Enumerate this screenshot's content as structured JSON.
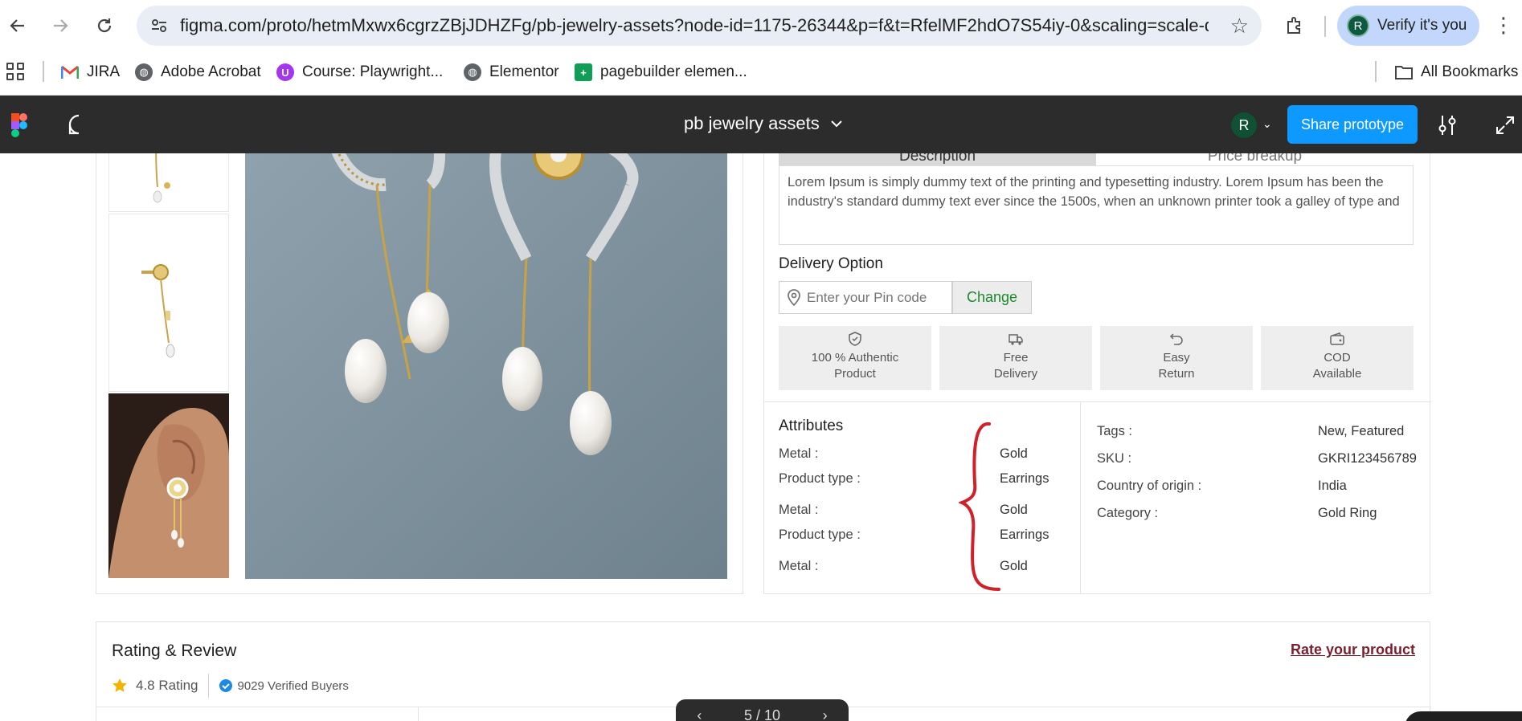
{
  "browser": {
    "url": "figma.com/proto/hetmMxwx6cgrzZBjJDHZFg/pb-jewelry-assets?node-id=1175-26344&p=f&t=RfelMF2hdO7S54iy-0&scaling=scale-do...",
    "verify_label": "Verify it's you",
    "avatar_initial": "R"
  },
  "bookmarks": {
    "items": [
      {
        "label": "JIRA",
        "icon": "gmail-icon"
      },
      {
        "label": "Adobe Acrobat",
        "icon": "globe-icon"
      },
      {
        "label": "Course: Playwright...",
        "icon": "udemy-icon"
      },
      {
        "label": "Elementor",
        "icon": "globe-icon"
      },
      {
        "label": "pagebuilder elemen...",
        "icon": "sheets-icon"
      }
    ],
    "all_bookmarks": "All Bookmarks"
  },
  "figma": {
    "file_title": "pb jewelry assets",
    "avatar_initial": "R",
    "share_label": "Share prototype"
  },
  "product": {
    "tabs": [
      {
        "label": "Description",
        "active": true
      },
      {
        "label": "Price  breakup",
        "active": false
      }
    ],
    "description": "Lorem Ipsum is simply dummy text of the printing and typesetting industry. Lorem Ipsum has been the industry's standard dummy text ever since the 1500s, when an unknown printer took a galley of type and",
    "delivery_title": "Delivery Option",
    "pin_placeholder": "Enter your Pin code",
    "change_label": "Change",
    "features": [
      {
        "line1": "100 % Authentic",
        "line2": "Product",
        "icon": "shield-check-icon"
      },
      {
        "line1": "Free",
        "line2": "Delivery",
        "icon": "truck-icon"
      },
      {
        "line1": "Easy",
        "line2": "Return",
        "icon": "return-icon"
      },
      {
        "line1": "COD",
        "line2": "Available",
        "icon": "wallet-icon"
      }
    ],
    "attributes_title": "Attributes",
    "attributes": [
      {
        "label": "Metal :",
        "value": "Gold"
      },
      {
        "label": "Product type :",
        "value": "Earrings"
      },
      {
        "label": "Metal :",
        "value": "Gold"
      },
      {
        "label": "Product type :",
        "value": "Earrings"
      },
      {
        "label": "Metal :",
        "value": "Gold"
      }
    ],
    "meta": [
      {
        "label": "Tags :",
        "value": "New, Featured"
      },
      {
        "label": "SKU :",
        "value": "GKRI123456789"
      },
      {
        "label": "Country of origin :",
        "value": "India"
      },
      {
        "label": "Category :",
        "value": "Gold Ring"
      }
    ],
    "annotation_color": "#d0202a"
  },
  "rating": {
    "title": "Rating & Review",
    "rate_link": "Rate your product",
    "rating_text": "4.8 Rating",
    "buyers_text": "9029 Verified Buyers",
    "star_color": "#f5b301",
    "verified_color": "#1e88e5"
  },
  "pager": {
    "text": "5 / 10"
  },
  "colors": {
    "figma_bar": "#2c2c2c",
    "share_button": "#0d99ff",
    "change_text": "#1a8a2e",
    "rate_link": "#7a1f2e"
  }
}
